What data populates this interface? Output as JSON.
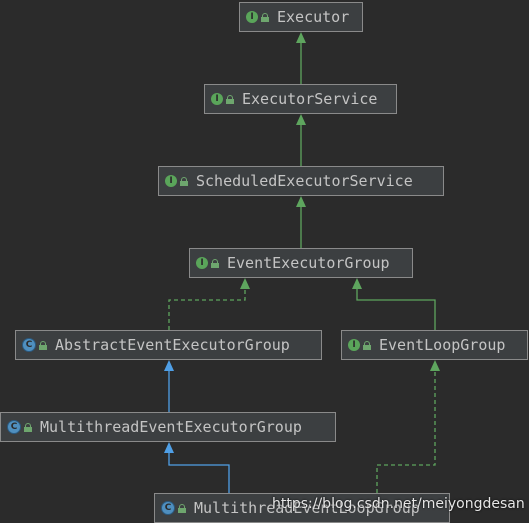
{
  "nodes": {
    "executor": {
      "label": "Executor",
      "kind": "interface"
    },
    "executor_service": {
      "label": "ExecutorService",
      "kind": "interface"
    },
    "scheduled_executor_service": {
      "label": "ScheduledExecutorService",
      "kind": "interface"
    },
    "event_executor_group": {
      "label": "EventExecutorGroup",
      "kind": "interface"
    },
    "abstract_event_executor_group": {
      "label": "AbstractEventExecutorGroup",
      "kind": "abstract-class"
    },
    "event_loop_group": {
      "label": "EventLoopGroup",
      "kind": "interface"
    },
    "multithread_event_executor_group": {
      "label": "MultithreadEventExecutorGroup",
      "kind": "abstract-class"
    },
    "multithread_event_loop_group": {
      "label": "MultithreadEventLoopGroup",
      "kind": "abstract-class"
    }
  },
  "badge_letters": {
    "interface": "I",
    "class": "C"
  },
  "edges": [
    {
      "from": "executor_service",
      "to": "executor",
      "type": "extends-interface"
    },
    {
      "from": "scheduled_executor_service",
      "to": "executor_service",
      "type": "extends-interface"
    },
    {
      "from": "event_executor_group",
      "to": "scheduled_executor_service",
      "type": "extends-interface"
    },
    {
      "from": "abstract_event_executor_group",
      "to": "event_executor_group",
      "type": "implements"
    },
    {
      "from": "event_loop_group",
      "to": "event_executor_group",
      "type": "extends-interface"
    },
    {
      "from": "multithread_event_executor_group",
      "to": "abstract_event_executor_group",
      "type": "extends-class"
    },
    {
      "from": "multithread_event_loop_group",
      "to": "multithread_event_executor_group",
      "type": "extends-class"
    },
    {
      "from": "multithread_event_loop_group",
      "to": "event_loop_group",
      "type": "implements"
    }
  ],
  "colors": {
    "background": "#2b2b2b",
    "node_fill": "#3c3f41",
    "node_border": "#8a8a8a",
    "interface_edge": "#5ea55e",
    "class_edge": "#4f9fe6",
    "text": "#c4c4c4"
  },
  "watermark": "https://blog.csdn.net/meiyongdesan"
}
